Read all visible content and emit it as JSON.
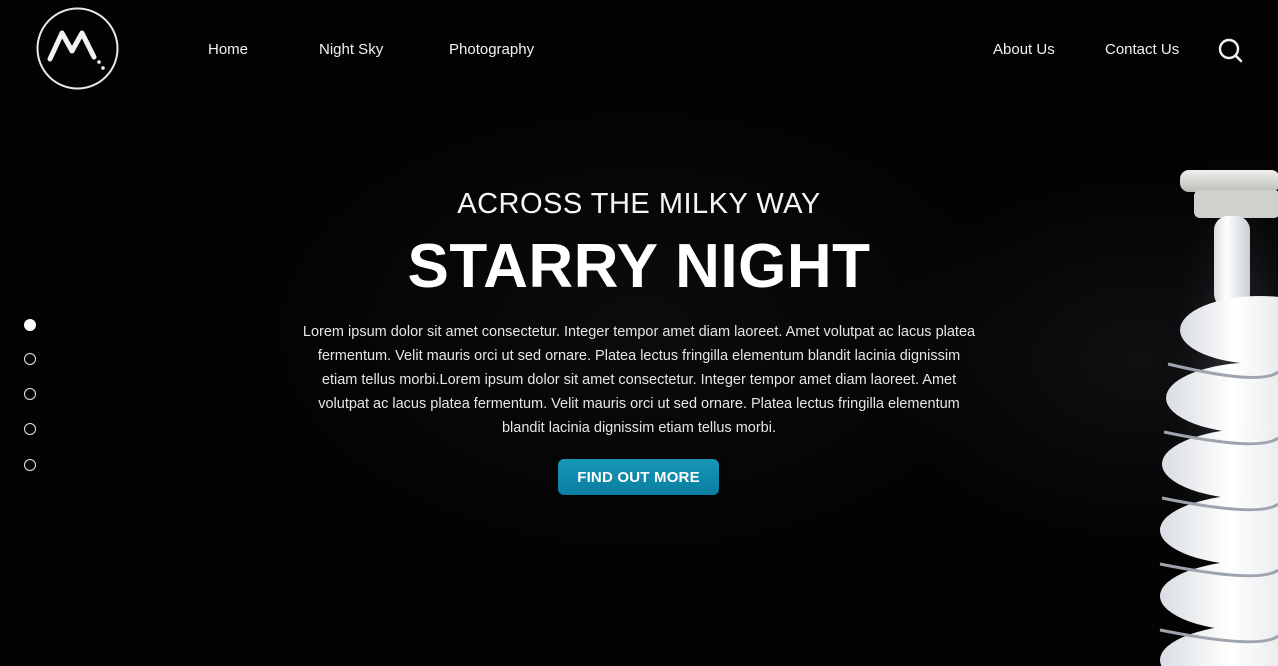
{
  "nav": {
    "logo_alt": "M logo",
    "left_links": [
      "Home",
      "Night Sky",
      "Photography"
    ],
    "right_links": [
      "About Us",
      "Contact Us"
    ],
    "search_icon": "search-icon"
  },
  "hero": {
    "subtitle": "ACROSS THE MILKY WAY",
    "title": "STARRY NIGHT",
    "body": "Lorem ipsum dolor sit amet consectetur. Integer tempor amet diam laoreet. Amet volutpat ac lacus platea fermentum. Velit mauris orci ut sed ornare. Platea lectus fringilla elementum blandit lacinia dignissim etiam tellus morbi.Lorem ipsum dolor sit amet consectetur. Integer tempor amet diam laoreet. Amet volutpat ac lacus platea fermentum. Velit mauris orci ut sed ornare. Platea lectus fringilla elementum blandit lacinia dignissim etiam tellus morbi.",
    "cta_label": "FIND OUT MORE"
  },
  "slider": {
    "dot_count": 5,
    "active_index": 0
  },
  "colors": {
    "background": "#030303",
    "text": "#ffffff",
    "cta_start": "#1796b5",
    "cta_end": "#0a7ea0"
  }
}
